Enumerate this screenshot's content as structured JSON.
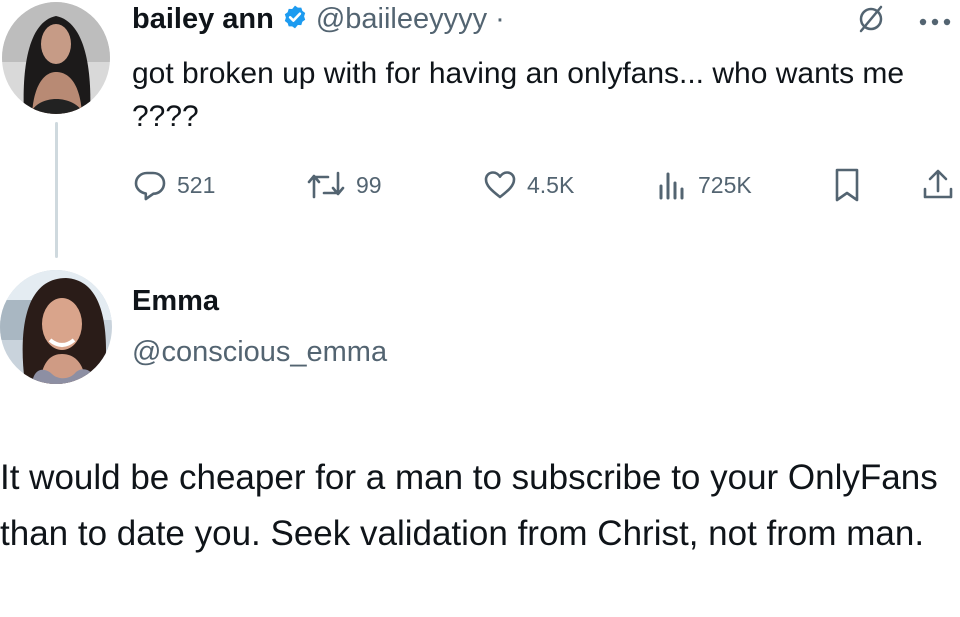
{
  "tweet": {
    "author_name": "bailey ann",
    "handle": "@baiileeyyyy",
    "separator": "·",
    "text": "got broken up with for having an onlyfans... who wants me ????",
    "stats": {
      "replies": "521",
      "retweets": "99",
      "likes": "4.5K",
      "views": "725K"
    },
    "icons": [
      "verified-badge-icon",
      "grok-icon",
      "more-icon",
      "reply-icon",
      "retweet-icon",
      "like-icon",
      "views-icon",
      "bookmark-icon",
      "share-icon"
    ]
  },
  "reply": {
    "author_name": "Emma",
    "handle": "@conscious_emma",
    "text": "It would be cheaper for a man to subscribe to your OnlyFans than to date you. Seek validation from Christ, not from man."
  },
  "colors": {
    "text": "#0f1419",
    "muted": "#536471",
    "verified": "#1d9bf0",
    "thread_line": "#cfd9de"
  }
}
